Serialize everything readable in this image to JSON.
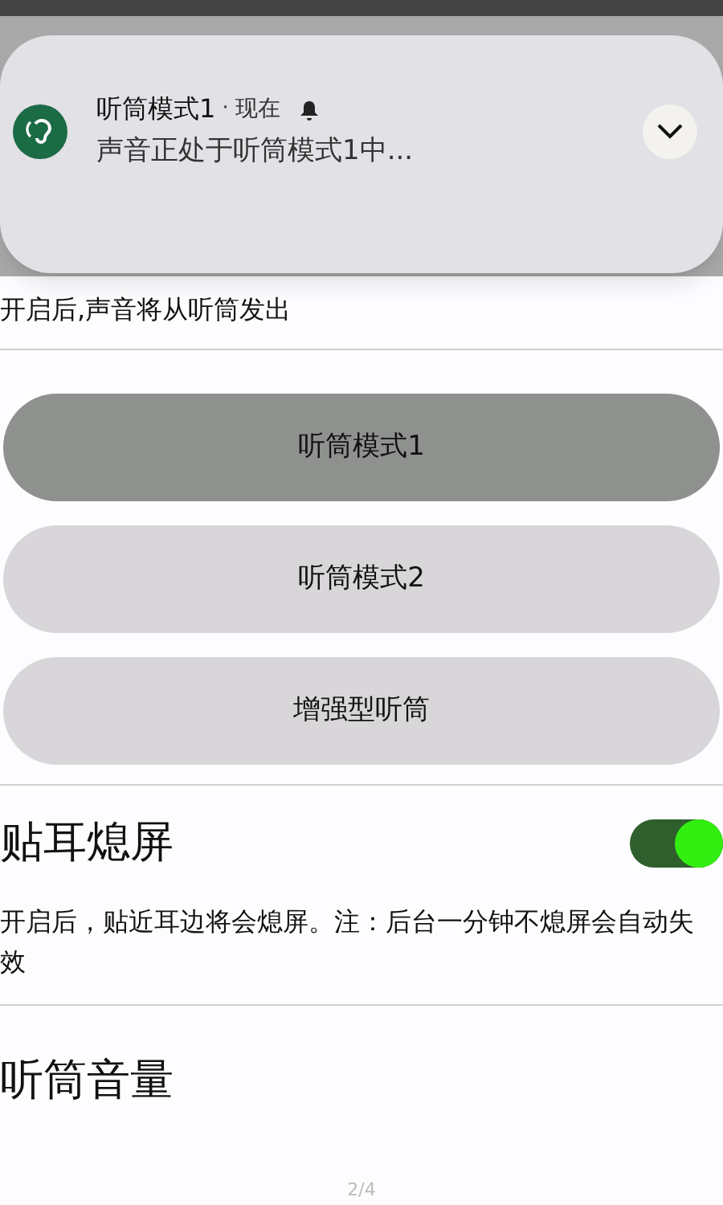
{
  "notification": {
    "app_name": "听筒模式1",
    "separator": "·",
    "time": "现在",
    "text": "声音正处于听筒模式1中..."
  },
  "sections": [
    {
      "kind": "text",
      "description": "开启后,声音将从听筒发出"
    },
    {
      "kind": "choices",
      "options": [
        {
          "label": "听筒模式1",
          "selected": true
        },
        {
          "label": "听筒模式2",
          "selected": false
        },
        {
          "label": "增强型听筒",
          "selected": false
        }
      ]
    },
    {
      "kind": "toggle",
      "title": "贴耳熄屏",
      "on": true,
      "description": "开启后，贴近耳边将会熄屏。注：后台一分钟不熄屏会自动失效"
    },
    {
      "kind": "heading",
      "title": "听筒音量"
    }
  ],
  "page_indicator": "2/4"
}
